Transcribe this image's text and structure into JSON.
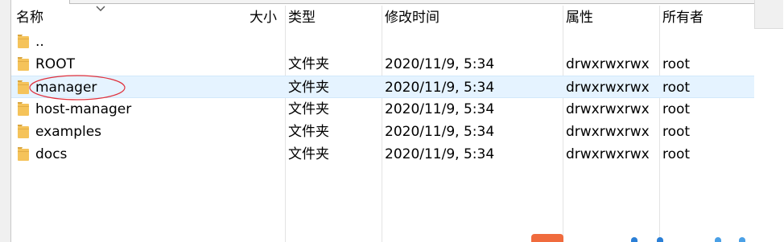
{
  "columns": {
    "name": "名称",
    "size": "大小",
    "type": "类型",
    "modified": "修改时间",
    "attributes": "属性",
    "owner": "所有者"
  },
  "files": [
    {
      "name": "..",
      "size": "",
      "type": "",
      "modified": "",
      "attributes": "",
      "owner": "",
      "selected": false
    },
    {
      "name": "ROOT",
      "size": "",
      "type": "文件夹",
      "modified": "2020/11/9, 5:34",
      "attributes": "drwxrwxrwx",
      "owner": "root",
      "selected": false
    },
    {
      "name": "manager",
      "size": "",
      "type": "文件夹",
      "modified": "2020/11/9, 5:34",
      "attributes": "drwxrwxrwx",
      "owner": "root",
      "selected": true
    },
    {
      "name": "host-manager",
      "size": "",
      "type": "文件夹",
      "modified": "2020/11/9, 5:34",
      "attributes": "drwxrwxrwx",
      "owner": "root",
      "selected": false
    },
    {
      "name": "examples",
      "size": "",
      "type": "文件夹",
      "modified": "2020/11/9, 5:34",
      "attributes": "drwxrwxrwx",
      "owner": "root",
      "selected": false
    },
    {
      "name": "docs",
      "size": "",
      "type": "文件夹",
      "modified": "2020/11/9, 5:34",
      "attributes": "drwxrwxrwx",
      "owner": "root",
      "selected": false
    }
  ],
  "colors": {
    "selected_row": "#e5f3ff",
    "folder": "#f5c35a",
    "annotation": "#e0303b"
  },
  "icons": {
    "sort": "sort-descending-chevron-icon",
    "folder": "folder-icon"
  }
}
